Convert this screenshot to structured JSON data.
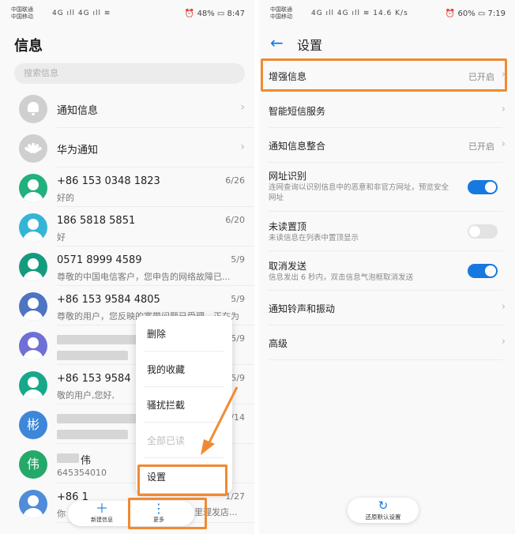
{
  "left": {
    "status": {
      "carrier1": "中国联通",
      "carrier2": "中国移动",
      "signal": "4G ıll 4G ıll ≋",
      "battery": "⏰ 48% ▭ 8:47"
    },
    "title": "信息",
    "search_placeholder": "搜索信息",
    "conversations": [
      {
        "name": "通知信息",
        "preview": "",
        "count": "",
        "avatar": "bell",
        "color": "#cfcfcf"
      },
      {
        "name": "华为通知",
        "preview": "",
        "count": "",
        "avatar": "huawei",
        "color": "#cfcfcf"
      },
      {
        "name": "+86 153 0348 1823",
        "preview": "好的",
        "count": "6/26",
        "avatar": "person",
        "color": "#22b07c"
      },
      {
        "name": "186 5818 5851",
        "preview": "好",
        "count": "6/20",
        "avatar": "person",
        "color": "#35b5d6"
      },
      {
        "name": "0571 8999 4589",
        "preview": "尊敬的中国电信客户，您申告的网络故障已...",
        "count": "5/9",
        "avatar": "person",
        "color": "#149b7e"
      },
      {
        "name": "+86 153 9584 4805",
        "preview": "尊敬的用户，您反映的宽带问题已受理，正在为",
        "count": "5/9",
        "avatar": "person",
        "color": "#4e74c2"
      },
      {
        "name": "",
        "preview": "",
        "count": "5/9",
        "avatar": "person",
        "color": "#6f6fd6"
      },
      {
        "name": "+86 153 9584",
        "preview": "敬的用户,您好,",
        "count": "5/9",
        "avatar": "person",
        "color": "#17a88a"
      },
      {
        "name": "",
        "preview": "",
        "count": "/14",
        "avatar": "letter",
        "letter": "彬",
        "color": "#3d86d8"
      },
      {
        "name": "伟",
        "preview": "645354010",
        "count": "",
        "avatar": "letter",
        "letter": "伟",
        "color": "#24a96a"
      },
      {
        "name": "+86 1",
        "preview": "你",
        "count": "1/27",
        "avatar": "person",
        "color": "#4f8cd9"
      }
    ],
    "menu": {
      "delete": "删除",
      "favorites": "我的收藏",
      "block": "骚扰拦截",
      "mark_all_read": "全部已读",
      "settings": "设置"
    },
    "peek_text": "里理发店...",
    "bottom": {
      "new_message": "新建信息",
      "more": "更多"
    }
  },
  "right": {
    "status": {
      "carrier1": "中国联通",
      "carrier2": "中国移动",
      "signal": "4G ıll 4G ıll ≋ 14.6 K/s",
      "battery": "⏰ 60% ▭ 7:19"
    },
    "title": "设置",
    "rows": [
      {
        "title": "增强信息",
        "value": "已开启"
      },
      {
        "title": "智能短信服务"
      },
      {
        "title": "通知信息整合",
        "value": "已开启"
      },
      {
        "title": "网址识别",
        "sub": "连网查询以识别信息中的恶意和非官方网址，预览安全网址",
        "toggle": "on"
      },
      {
        "title": "未读置顶",
        "sub": "未读信息在列表中置顶显示",
        "toggle": "off"
      },
      {
        "title": "取消发送",
        "sub": "信息发出 6 秒内，双击信息气泡框取消发送",
        "toggle": "on"
      },
      {
        "title": "通知铃声和振动"
      },
      {
        "title": "高级"
      }
    ],
    "restore": "还原默认设置"
  },
  "colors": {
    "accent": "#1778e0",
    "highlight": "#f08a32"
  }
}
